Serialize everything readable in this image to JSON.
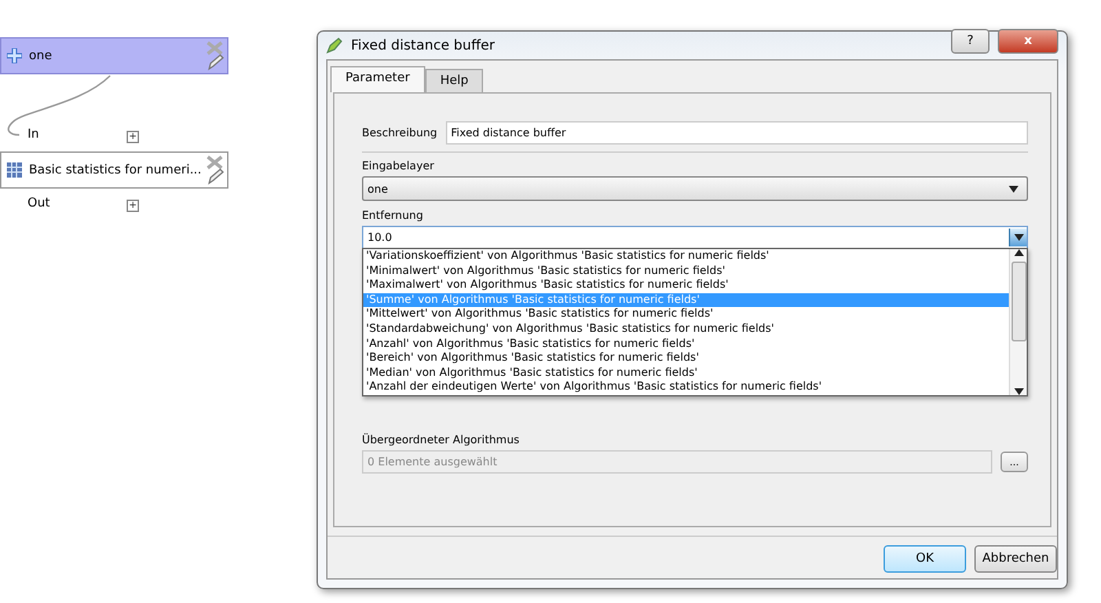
{
  "canvas": {
    "nodes": [
      {
        "kind": "input",
        "label": "one",
        "selected": true
      },
      {
        "kind": "algorithm",
        "label": "Basic statistics for numeri...",
        "selected": false
      }
    ],
    "ports": [
      {
        "label": "In",
        "expand": "+"
      },
      {
        "label": "Out",
        "expand": "+"
      }
    ]
  },
  "dialog": {
    "title": "Fixed distance buffer",
    "help_button": "?",
    "close_button": "x",
    "tabs": [
      {
        "label": "Parameter",
        "selected": true
      },
      {
        "label": "Help",
        "selected": false
      }
    ],
    "description": {
      "label": "Beschreibung",
      "value": "Fixed distance buffer"
    },
    "input_layer": {
      "label": "Eingabelayer",
      "value": "one"
    },
    "distance": {
      "label": "Entfernung",
      "value": "10.0",
      "expanded": true,
      "options": [
        {
          "label": "'Variationskoeffizient' von Algorithmus 'Basic statistics for numeric fields'",
          "selected": false
        },
        {
          "label": "'Minimalwert' von Algorithmus 'Basic statistics for numeric fields'",
          "selected": false
        },
        {
          "label": "'Maximalwert' von Algorithmus 'Basic statistics for numeric fields'",
          "selected": false
        },
        {
          "label": "'Summe' von Algorithmus 'Basic statistics for numeric fields'",
          "selected": true
        },
        {
          "label": "'Mittelwert' von Algorithmus 'Basic statistics for numeric fields'",
          "selected": false
        },
        {
          "label": "'Standardabweichung' von Algorithmus 'Basic statistics for numeric fields'",
          "selected": false
        },
        {
          "label": "'Anzahl' von Algorithmus 'Basic statistics for numeric fields'",
          "selected": false
        },
        {
          "label": "'Bereich' von Algorithmus 'Basic statistics for numeric fields'",
          "selected": false
        },
        {
          "label": "'Median' von Algorithmus 'Basic statistics for numeric fields'",
          "selected": false
        },
        {
          "label": "'Anzahl der eindeutigen Werte' von Algorithmus 'Basic statistics for numeric fields'",
          "selected": false
        }
      ]
    },
    "parent": {
      "label": "Übergeordneter Algorithmus",
      "value": "0 Elemente ausgewählt",
      "disabled": true,
      "button": "..."
    },
    "buttons": [
      "OK",
      "Abbrechen"
    ]
  }
}
